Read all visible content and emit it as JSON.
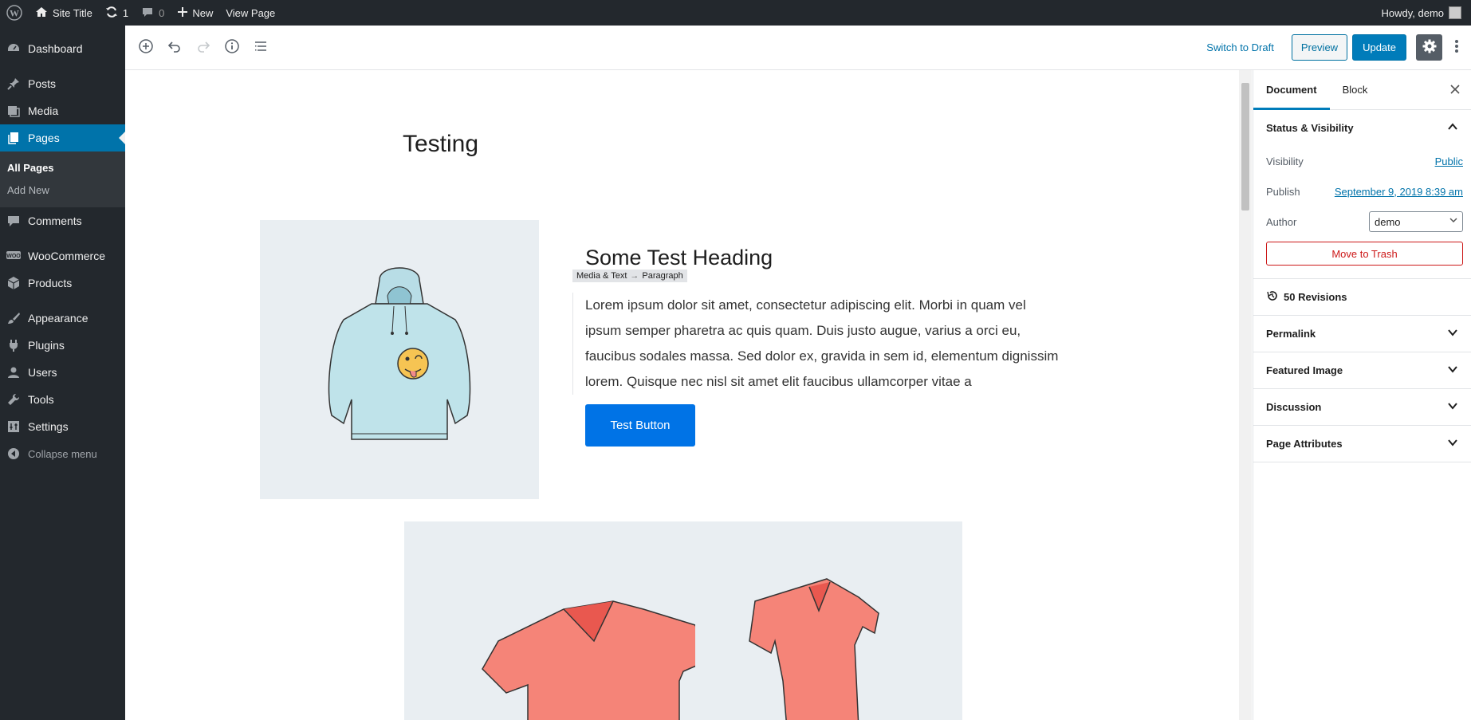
{
  "adminbar": {
    "site_title": "Site Title",
    "updates_count": "1",
    "comments_count": "0",
    "new_label": "New",
    "view_page_label": "View Page",
    "howdy": "Howdy, demo"
  },
  "sidebar": {
    "items": [
      {
        "label": "Dashboard",
        "icon": "dashboard-icon"
      },
      {
        "label": "Posts",
        "icon": "pin-icon"
      },
      {
        "label": "Media",
        "icon": "media-icon"
      },
      {
        "label": "Pages",
        "icon": "pages-icon"
      },
      {
        "label": "Comments",
        "icon": "comment-icon"
      },
      {
        "label": "WooCommerce",
        "icon": "woocommerce-icon"
      },
      {
        "label": "Products",
        "icon": "box-icon"
      },
      {
        "label": "Appearance",
        "icon": "brush-icon"
      },
      {
        "label": "Plugins",
        "icon": "plug-icon"
      },
      {
        "label": "Users",
        "icon": "user-icon"
      },
      {
        "label": "Tools",
        "icon": "wrench-icon"
      },
      {
        "label": "Settings",
        "icon": "settings-icon"
      }
    ],
    "submenu": [
      "All Pages",
      "Add New"
    ],
    "collapse_label": "Collapse menu"
  },
  "toolbar": {
    "switch_to_draft": "Switch to Draft",
    "preview": "Preview",
    "update": "Update"
  },
  "editor": {
    "title": "Testing",
    "heading": "Some Test Heading",
    "breadcrumb": [
      "Media & Text",
      "Paragraph"
    ],
    "breadcrumb_arrow": "→",
    "paragraph": "Lorem ipsum dolor sit amet, consectetur adipiscing elit. Morbi in quam vel ipsum semper pharetra ac quis quam. Duis justo augue, varius a orci eu, faucibus sodales massa. Sed dolor ex, gravida in sem id, elementum dignissim lorem. Quisque nec nisl sit amet elit faucibus ullamcorper vitae a",
    "button_label": "Test Button"
  },
  "panel": {
    "tabs": [
      "Document",
      "Block"
    ],
    "status_visibility": "Status & Visibility",
    "visibility_label": "Visibility",
    "visibility_value": "Public",
    "publish_label": "Publish",
    "publish_value": "September 9, 2019 8:39 am",
    "author_label": "Author",
    "author_value": "demo",
    "trash_label": "Move to Trash",
    "revisions": "50 Revisions",
    "sections": [
      "Permalink",
      "Featured Image",
      "Discussion",
      "Page Attributes"
    ]
  },
  "colors": {
    "admin_dark": "#23282d",
    "accent_blue": "#0073aa",
    "button_blue": "#0073e6",
    "danger": "#cc1818"
  }
}
